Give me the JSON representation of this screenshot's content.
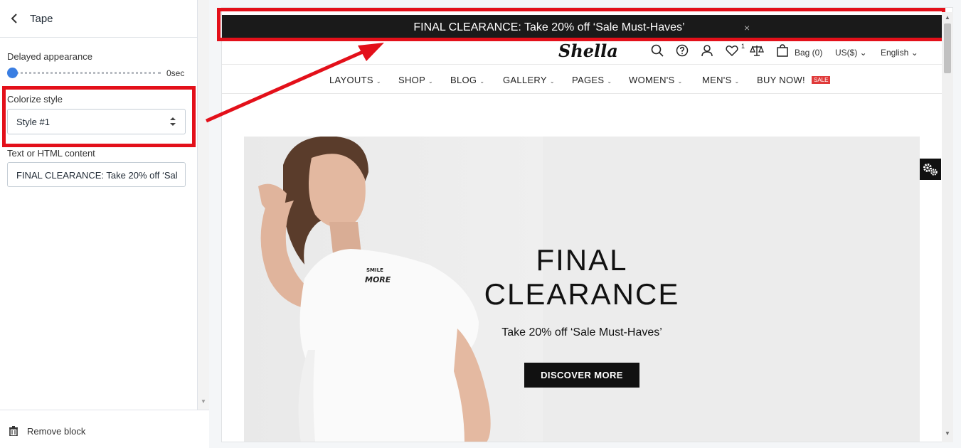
{
  "editor": {
    "title": "Tape",
    "delay_label": "Delayed appearance",
    "delay_value": "0sec",
    "colorize_label": "Colorize style",
    "colorize_value": "Style #1",
    "content_label": "Text or HTML content",
    "content_value": "FINAL CLEARANCE: Take 20% off ‘Sal",
    "remove_label": "Remove block"
  },
  "tape": {
    "text": "FINAL CLEARANCE: Take 20% off ‘Sale Must-Haves’",
    "close": "×"
  },
  "header": {
    "logo": "Shella",
    "wishlist_count": "1",
    "bag": "Bag (0)",
    "currency": "US($) ⌄",
    "language": "English ⌄"
  },
  "nav": {
    "items": [
      "LAYOUTS",
      "SHOP",
      "BLOG",
      "GALLERY",
      "PAGES",
      "WOMEN'S",
      "MEN'S",
      "BUY NOW!"
    ],
    "sale_badge": "SALE"
  },
  "hero": {
    "title_line1": "FINAL",
    "title_line2": "CLEARANCE",
    "subtitle": "Take 20% off ‘Sale Must-Haves’",
    "button": "DISCOVER MORE",
    "shirt_line1": "SMILE",
    "shirt_line2": "MORE"
  },
  "colors": {
    "accent_red": "#e3101a",
    "tape_bg": "#1a1a1a",
    "slider_blue": "#3a7ee2",
    "sale_red": "#e03a3a"
  },
  "icons": [
    "chevron-left-icon",
    "select-arrows-icon",
    "trash-icon",
    "search-icon",
    "help-icon",
    "user-icon",
    "heart-icon",
    "compare-icon",
    "bag-icon",
    "gear-icon"
  ]
}
